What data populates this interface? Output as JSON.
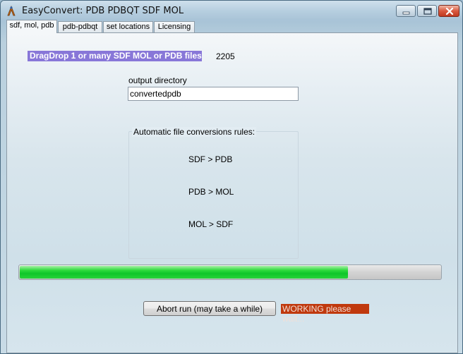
{
  "window": {
    "title": "EasyConvert: PDB PDBQT SDF MOL",
    "controls": {
      "minimize_icon": "minimize-icon",
      "maximize_icon": "maximize-icon",
      "close_icon": "close-icon"
    }
  },
  "tabs": [
    {
      "label": "sdf, mol, pdb",
      "active": true
    },
    {
      "label": "pdb-pdbqt",
      "active": false
    },
    {
      "label": "set locations",
      "active": false
    },
    {
      "label": "Licensing",
      "active": false
    }
  ],
  "main": {
    "drop_label": "DragDrop 1 or many SDF MOL or PDB files",
    "file_count": "2205",
    "output_dir_label": "output directory",
    "output_dir_value": "convertedpdb",
    "rules_title": "Automatic file conversions rules:",
    "rules": [
      "SDF > PDB",
      "PDB > MOL",
      "MOL > SDF"
    ],
    "progress_fraction": 0.78,
    "abort_label": "Abort run (may take a while)",
    "status_text": "WORKING please wait..."
  },
  "colors": {
    "drop_label_bg": "#8877d8",
    "status_bg": "#c0390e",
    "progress_fill": "#0fc62a"
  }
}
